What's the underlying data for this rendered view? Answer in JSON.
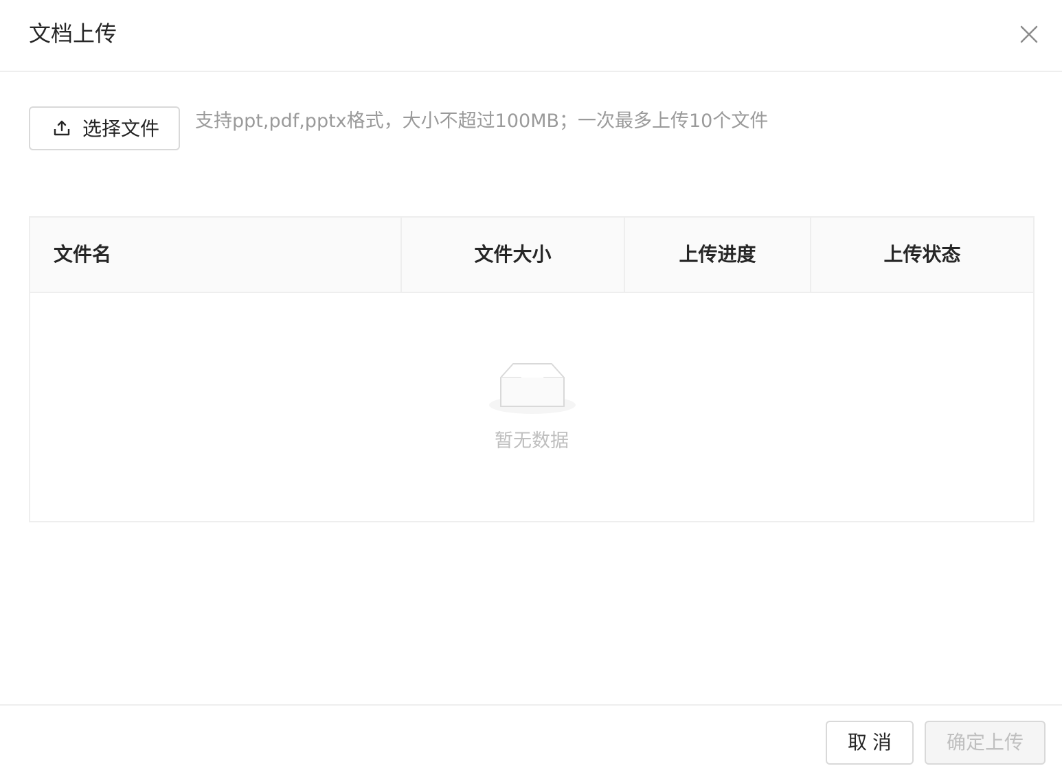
{
  "modal": {
    "title": "文档上传",
    "close_icon": "close-icon"
  },
  "upload": {
    "button_label": "选择文件",
    "button_icon": "upload-icon",
    "hint": "支持ppt,pdf,pptx格式，大小不超过100MB；一次最多上传10个文件"
  },
  "table": {
    "columns": [
      "文件名",
      "文件大小",
      "上传进度",
      "上传状态"
    ],
    "rows": [],
    "empty_icon": "empty-inbox-icon",
    "empty_text": "暂无数据"
  },
  "footer": {
    "cancel_label": "取消",
    "ok_label": "确定上传",
    "ok_disabled": true
  },
  "colors": {
    "text_primary": "#262626",
    "text_secondary": "#9a9a9a",
    "text_disabled": "#bfbfbf",
    "border": "#d9d9d9",
    "divider": "#eeeeee",
    "table_header_bg": "#fafafa",
    "disabled_bg": "#f5f5f5"
  }
}
